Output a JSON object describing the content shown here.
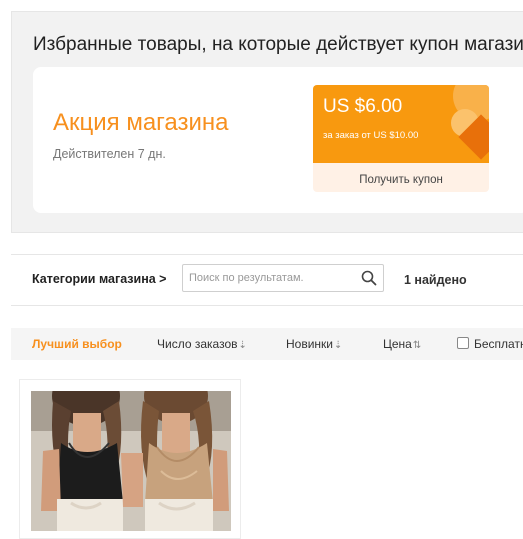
{
  "coupon_section": {
    "heading": "Избранные товары, на которые действует купон магази",
    "promo_title": "Акция магазина",
    "validity": "Действителен 7 дн.",
    "coupon": {
      "amount": "US $6.00",
      "condition": "за заказ от US $10.00",
      "get_label": "Получить купон"
    }
  },
  "store_bar": {
    "categories_label": "Категории магазина >",
    "search_placeholder": "Поиск по результатам.",
    "results_count": "1 найдено"
  },
  "sort_bar": {
    "best_match": "Лучший выбор",
    "orders": "Число заказов",
    "orders_arrow": "⇣",
    "newest": "Новинки",
    "newest_arrow": "⇣",
    "price": "Цена",
    "price_arrow": "⇅",
    "free_shipping": "Бесплатн"
  },
  "colors": {
    "accent": "#f7901e",
    "coupon_bg": "#f8990f",
    "coupon_bottom": "#fff1e6"
  }
}
